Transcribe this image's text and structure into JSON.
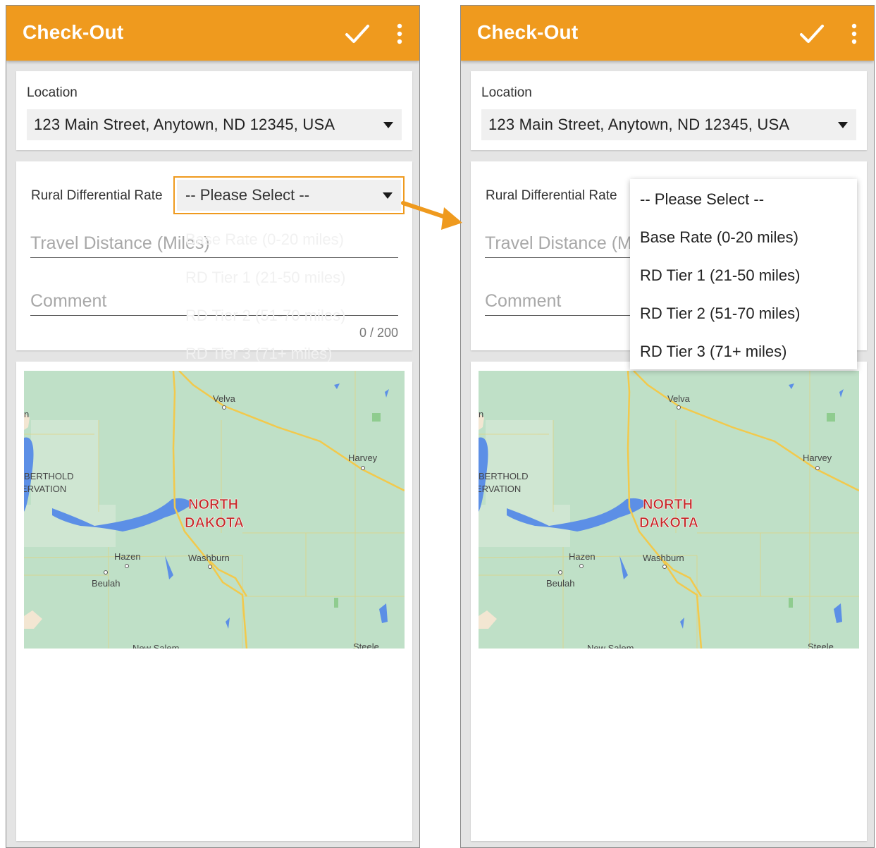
{
  "app": {
    "title": "Check-Out"
  },
  "location": {
    "label": "Location",
    "value": "123 Main Street, Anytown, ND 12345, USA"
  },
  "form": {
    "rate_label": "Rural Differential Rate",
    "rate_placeholder": "-- Please Select --",
    "travel_placeholder": "Travel Distance (Miles)",
    "comment_placeholder": "Comment",
    "comment_counter": "0 / 200"
  },
  "rate_options": [
    {
      "label": "-- Please Select --"
    },
    {
      "label": "Base Rate (0-20 miles)"
    },
    {
      "label": "RD Tier 1 (21-50 miles)"
    },
    {
      "label": "RD Tier 2 (51-70 miles)"
    },
    {
      "label": "RD Tier 3 (71+ miles)"
    }
  ],
  "map": {
    "labels": {
      "velva": "Velva",
      "harvey": "Harvey",
      "berthold": "BERTHOLD",
      "ervation": "ERVATION",
      "state_north": "NORTH",
      "state_dakota": "DAKOTA",
      "hazen": "Hazen",
      "washburn": "Washburn",
      "beulah": "Beulah",
      "new_salem": "New Salem",
      "steele": "Steele",
      "edge_n": "n"
    },
    "colors": {
      "land": "#bfe0c7",
      "water": "#5c8fe6",
      "road": "#f2c94c",
      "label": "#c62828"
    }
  },
  "icons": {
    "confirm": "check-icon",
    "menu": "more-vert-icon",
    "dropdown": "caret-down-icon",
    "callout": "arrow-icon"
  },
  "colors": {
    "accent": "#ef9a1e",
    "background": "#e4e4e4"
  }
}
